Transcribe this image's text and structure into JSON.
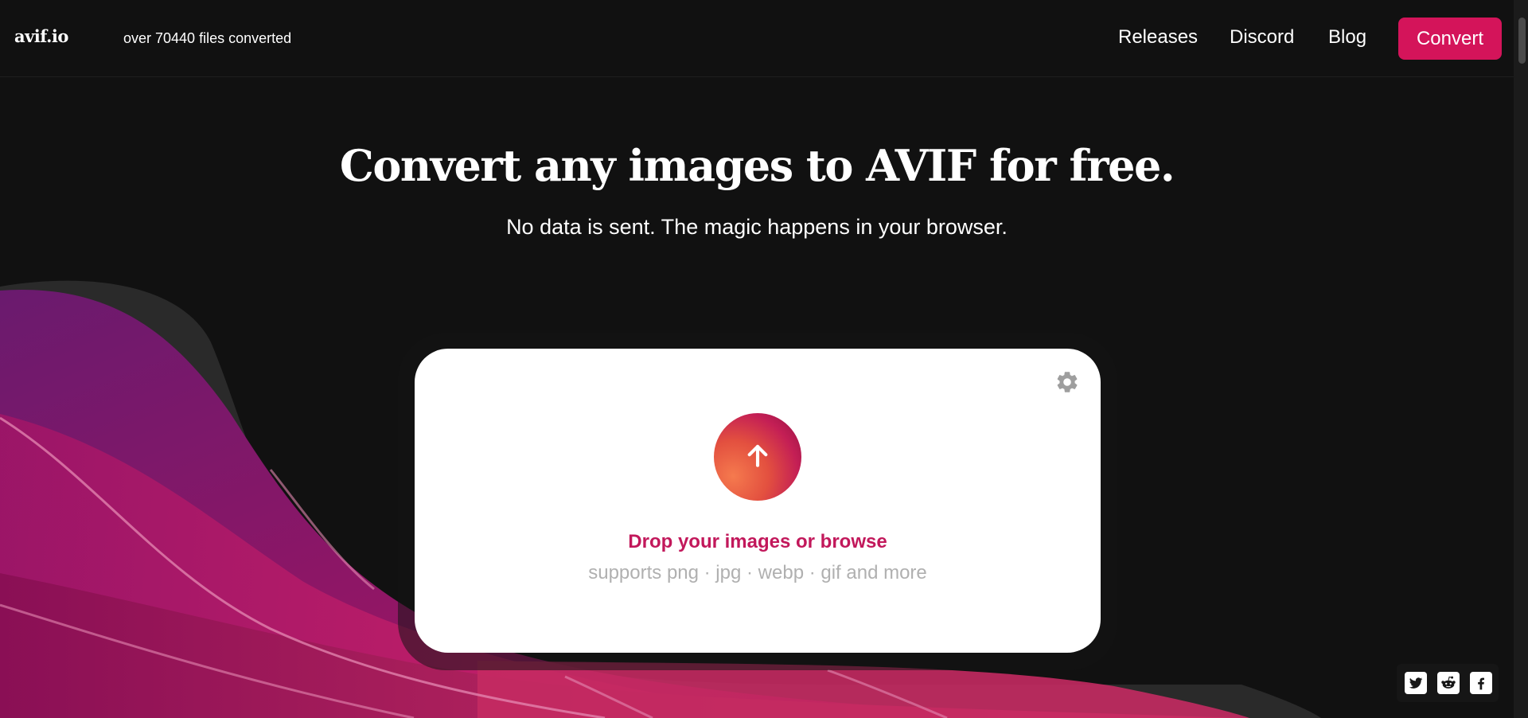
{
  "header": {
    "logo": "avif.io",
    "counter": "over 70440 files converted",
    "nav": {
      "releases": "Releases",
      "discord": "Discord",
      "blog": "Blog"
    },
    "convert_label": "Convert"
  },
  "hero": {
    "headline": "Convert any images to AVIF for free.",
    "subheadline": "No data is sent. The magic happens in your browser."
  },
  "uploader": {
    "drop_text": "Drop your images or ",
    "browse_text": "browse",
    "supports_text": "supports png · jpg · webp · gif and more",
    "icons": {
      "upload": "arrow-up-icon",
      "settings": "gear-icon"
    }
  },
  "social": {
    "icons": [
      "twitter-icon",
      "reddit-icon",
      "facebook-icon"
    ]
  },
  "colors": {
    "background": "#111111",
    "accent": "#d4145a",
    "drop_text": "#c2185b",
    "muted_text": "#b0b0b0",
    "card": "#ffffff"
  }
}
